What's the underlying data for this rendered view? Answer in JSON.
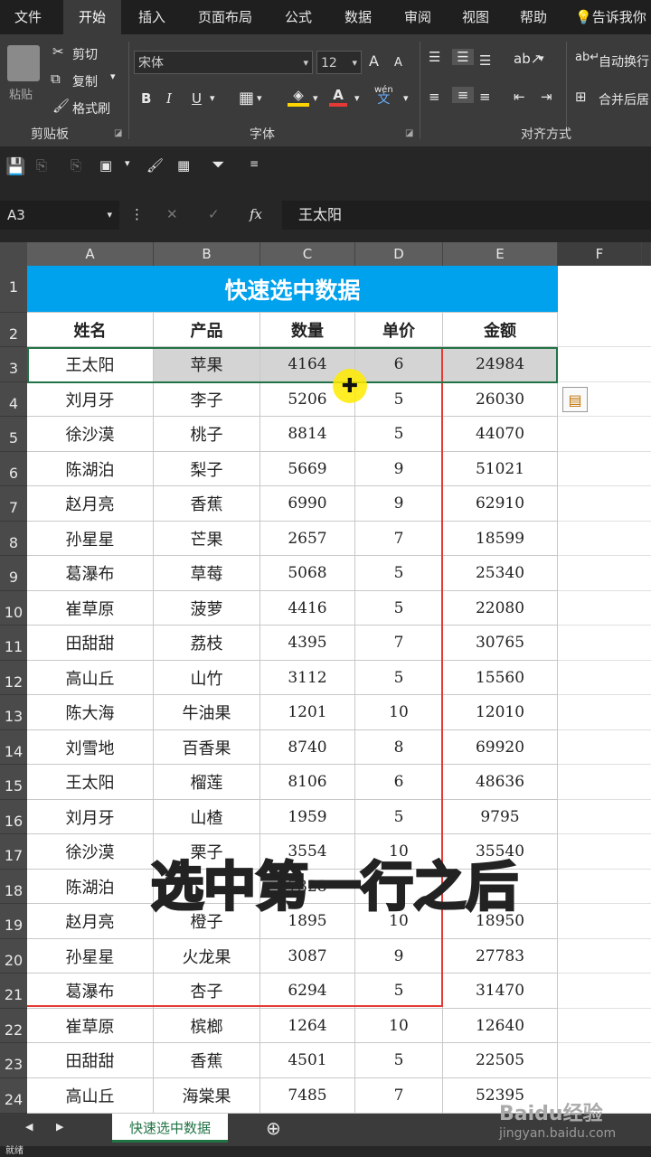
{
  "ribbon_tabs": [
    "文件",
    "开始",
    "插入",
    "页面布局",
    "公式",
    "数据",
    "审阅",
    "视图",
    "帮助",
    "告诉我你"
  ],
  "ribbon": {
    "clipboard": {
      "cut": "剪切",
      "copy": "复制",
      "format_painter": "格式刷",
      "paste": "粘贴",
      "group": "剪贴板"
    },
    "font": {
      "name": "宋体",
      "size": "12",
      "group": "字体",
      "bold": "B",
      "italic": "I",
      "underline": "U",
      "grow": "A",
      "shrink": "A",
      "phonetic_top": "wén",
      "phonetic_bottom": "文"
    },
    "alignment": {
      "wrap": "自动换行",
      "merge": "合并后居",
      "group": "对齐方式"
    }
  },
  "formula_bar": {
    "name_box": "A3",
    "fx": "fx",
    "value": "王太阳"
  },
  "columns": [
    "A",
    "B",
    "C",
    "D",
    "E",
    "F"
  ],
  "title": "快速选中数据",
  "headers": [
    "姓名",
    "产品",
    "数量",
    "单价",
    "金额"
  ],
  "rows": [
    [
      "王太阳",
      "苹果",
      "4164",
      "6",
      "24984"
    ],
    [
      "刘月牙",
      "李子",
      "5206",
      "5",
      "26030"
    ],
    [
      "徐沙漠",
      "桃子",
      "8814",
      "5",
      "44070"
    ],
    [
      "陈湖泊",
      "梨子",
      "5669",
      "9",
      "51021"
    ],
    [
      "赵月亮",
      "香蕉",
      "6990",
      "9",
      "62910"
    ],
    [
      "孙星星",
      "芒果",
      "2657",
      "7",
      "18599"
    ],
    [
      "葛瀑布",
      "草莓",
      "5068",
      "5",
      "25340"
    ],
    [
      "崔草原",
      "菠萝",
      "4416",
      "5",
      "22080"
    ],
    [
      "田甜甜",
      "荔枝",
      "4395",
      "7",
      "30765"
    ],
    [
      "高山丘",
      "山竹",
      "3112",
      "5",
      "15560"
    ],
    [
      "陈大海",
      "牛油果",
      "1201",
      "10",
      "12010"
    ],
    [
      "刘雪地",
      "百香果",
      "8740",
      "8",
      "69920"
    ],
    [
      "王太阳",
      "榴莲",
      "8106",
      "6",
      "48636"
    ],
    [
      "刘月牙",
      "山楂",
      "1959",
      "5",
      "9795"
    ],
    [
      "徐沙漠",
      "栗子",
      "3554",
      "10",
      "35540"
    ],
    [
      "陈湖泊",
      "",
      "7328",
      "",
      ""
    ],
    [
      "赵月亮",
      "橙子",
      "1895",
      "10",
      "18950"
    ],
    [
      "孙星星",
      "火龙果",
      "3087",
      "9",
      "27783"
    ],
    [
      "葛瀑布",
      "杏子",
      "6294",
      "5",
      "31470"
    ],
    [
      "崔草原",
      "槟榔",
      "1264",
      "10",
      "12640"
    ],
    [
      "田甜甜",
      "香蕉",
      "4501",
      "5",
      "22505"
    ],
    [
      "高山丘",
      "海棠果",
      "7485",
      "7",
      "52395"
    ]
  ],
  "subtitle": "选中第一行之后",
  "sheet_tab": "快速选中数据",
  "status": "就绪",
  "watermark": {
    "logo": "Baidu经验",
    "url": "jingyan.baidu.com"
  },
  "colors": {
    "title_bg": "#00a2ed",
    "selection_border": "#217346",
    "annotation_red": "#e53935",
    "cursor_yellow": "#ffeb00"
  }
}
